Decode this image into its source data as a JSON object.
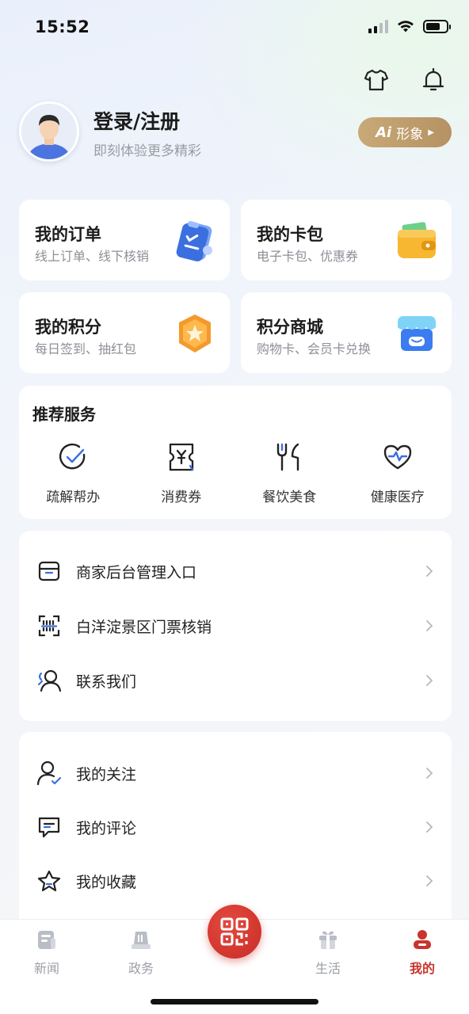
{
  "status_bar": {
    "time": "15:52"
  },
  "profile": {
    "title": "登录/注册",
    "subtitle": "即刻体验更多精彩",
    "ai_button": {
      "badge": "Ai",
      "label": "形象"
    }
  },
  "quick_cards": [
    {
      "title": "我的订单",
      "subtitle": "线上订单、线下核销",
      "icon": "clipboard-order-icon"
    },
    {
      "title": "我的卡包",
      "subtitle": "电子卡包、优惠券",
      "icon": "wallet-icon"
    },
    {
      "title": "我的积分",
      "subtitle": "每日签到、抽红包",
      "icon": "star-medal-icon"
    },
    {
      "title": "积分商城",
      "subtitle": "购物卡、会员卡兑换",
      "icon": "store-icon"
    }
  ],
  "recommended": {
    "title": "推荐服务",
    "items": [
      {
        "label": "疏解帮办",
        "icon": "check-circle-icon"
      },
      {
        "label": "消费券",
        "icon": "coupon-yen-icon"
      },
      {
        "label": "餐饮美食",
        "icon": "fork-knife-icon"
      },
      {
        "label": "健康医疗",
        "icon": "heart-pulse-icon"
      }
    ]
  },
  "service_list": [
    {
      "label": "商家后台管理入口",
      "icon": "shop-icon"
    },
    {
      "label": "白洋淀景区门票核销",
      "icon": "scan-ticket-icon"
    },
    {
      "label": "联系我们",
      "icon": "contact-icon"
    }
  ],
  "personal_list": [
    {
      "label": "我的关注",
      "icon": "user-follow-icon"
    },
    {
      "label": "我的评论",
      "icon": "comment-icon"
    },
    {
      "label": "我的收藏",
      "icon": "star-icon"
    }
  ],
  "tab_bar": {
    "tabs": [
      {
        "label": "新闻",
        "icon": "news-icon",
        "active": false
      },
      {
        "label": "政务",
        "icon": "government-icon",
        "active": false
      },
      {
        "label": "生活",
        "icon": "gift-icon",
        "active": false
      },
      {
        "label": "我的",
        "icon": "profile-icon",
        "active": true
      }
    ],
    "center_button": {
      "icon": "qr-code-icon"
    }
  },
  "colors": {
    "accent_red": "#c8352e",
    "gold": "#c8a977",
    "icon_blue": "#3b6fe0"
  }
}
